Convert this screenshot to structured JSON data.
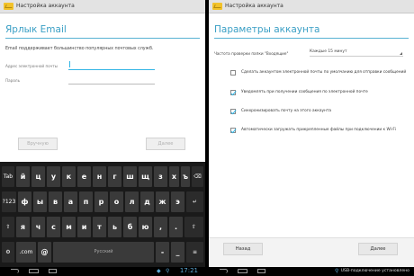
{
  "left": {
    "actionbar_title": "Настройка аккаунта",
    "title": "Ярлык Email",
    "intro": "Email поддерживает большинство популярных почтовых служб.",
    "email_label": "Адрес электронной почты",
    "email_value": "",
    "password_label": "Пароль",
    "password_value": "",
    "manual_button": "Вручную",
    "next_button": "Далее",
    "keyboard": {
      "row1": [
        "Tab",
        "й",
        "ц",
        "у",
        "к",
        "е",
        "н",
        "г",
        "ш",
        "щ",
        "з",
        "х",
        "ъ",
        "⌫"
      ],
      "row2": [
        "?123",
        "ф",
        "ы",
        "в",
        "а",
        "п",
        "р",
        "о",
        "л",
        "д",
        "ж",
        "э",
        "↵"
      ],
      "row3": [
        "⇧",
        "я",
        "ч",
        "с",
        "м",
        "и",
        "т",
        "ь",
        "б",
        "ю",
        ",",
        ".",
        "⇧"
      ],
      "row4": [
        "⚙",
        ".com",
        "@",
        "Русский",
        "-",
        "_",
        "≡"
      ]
    },
    "clock": "17:21"
  },
  "right": {
    "actionbar_title": "Настройка аккаунта",
    "title": "Параметры аккаунта",
    "frequency_label": "Частота проверки папки \"Входящие\"",
    "frequency_value": "Каждые 15 минут",
    "options": [
      {
        "label": "Сделать аккаунтом электронной почты по умолчанию для отправки сообщений",
        "checked": false
      },
      {
        "label": "Уведомлять при получении сообщения по электронной почте",
        "checked": true
      },
      {
        "label": "Синхронизировать почту на этого аккаунта",
        "checked": true
      },
      {
        "label": "Автоматически загружать прикрепленные файлы при подключении к Wi-Fi",
        "checked": true
      }
    ],
    "back_button": "Назад",
    "next_button": "Далее",
    "usb_text": "USB-подключение установлено"
  },
  "colors": {
    "accent": "#33b5e5",
    "title": "#3a9fc5",
    "actionbar": "#e3e3e3",
    "keyboard_bg": "#1a1a1a",
    "key_bg": "#3a3a3a"
  }
}
